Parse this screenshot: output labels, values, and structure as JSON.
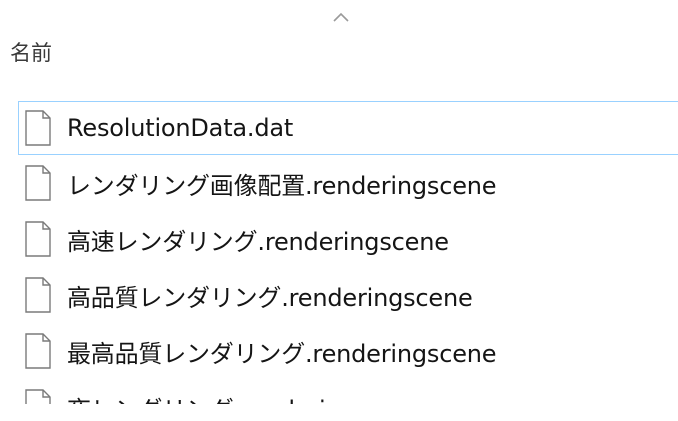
{
  "header": {
    "name_column": "名前",
    "sort_icon": "chevron-up-icon"
  },
  "files": [
    {
      "name": "ResolutionData.dat",
      "icon": "file-icon",
      "selected": true
    },
    {
      "name": "レンダリング画像配置.renderingscene",
      "icon": "file-icon",
      "selected": false
    },
    {
      "name": "高速レンダリング.renderingscene",
      "icon": "file-icon",
      "selected": false
    },
    {
      "name": "高品質レンダリング.renderingscene",
      "icon": "file-icon",
      "selected": false
    },
    {
      "name": "最高品質レンダリング.renderingscene",
      "icon": "file-icon",
      "selected": false
    },
    {
      "name": "夜レンダリング.renderingscene",
      "icon": "file-icon",
      "selected": false
    }
  ],
  "colors": {
    "selection_border": "#99d1ff",
    "icon_stroke": "#7a7a7a"
  }
}
